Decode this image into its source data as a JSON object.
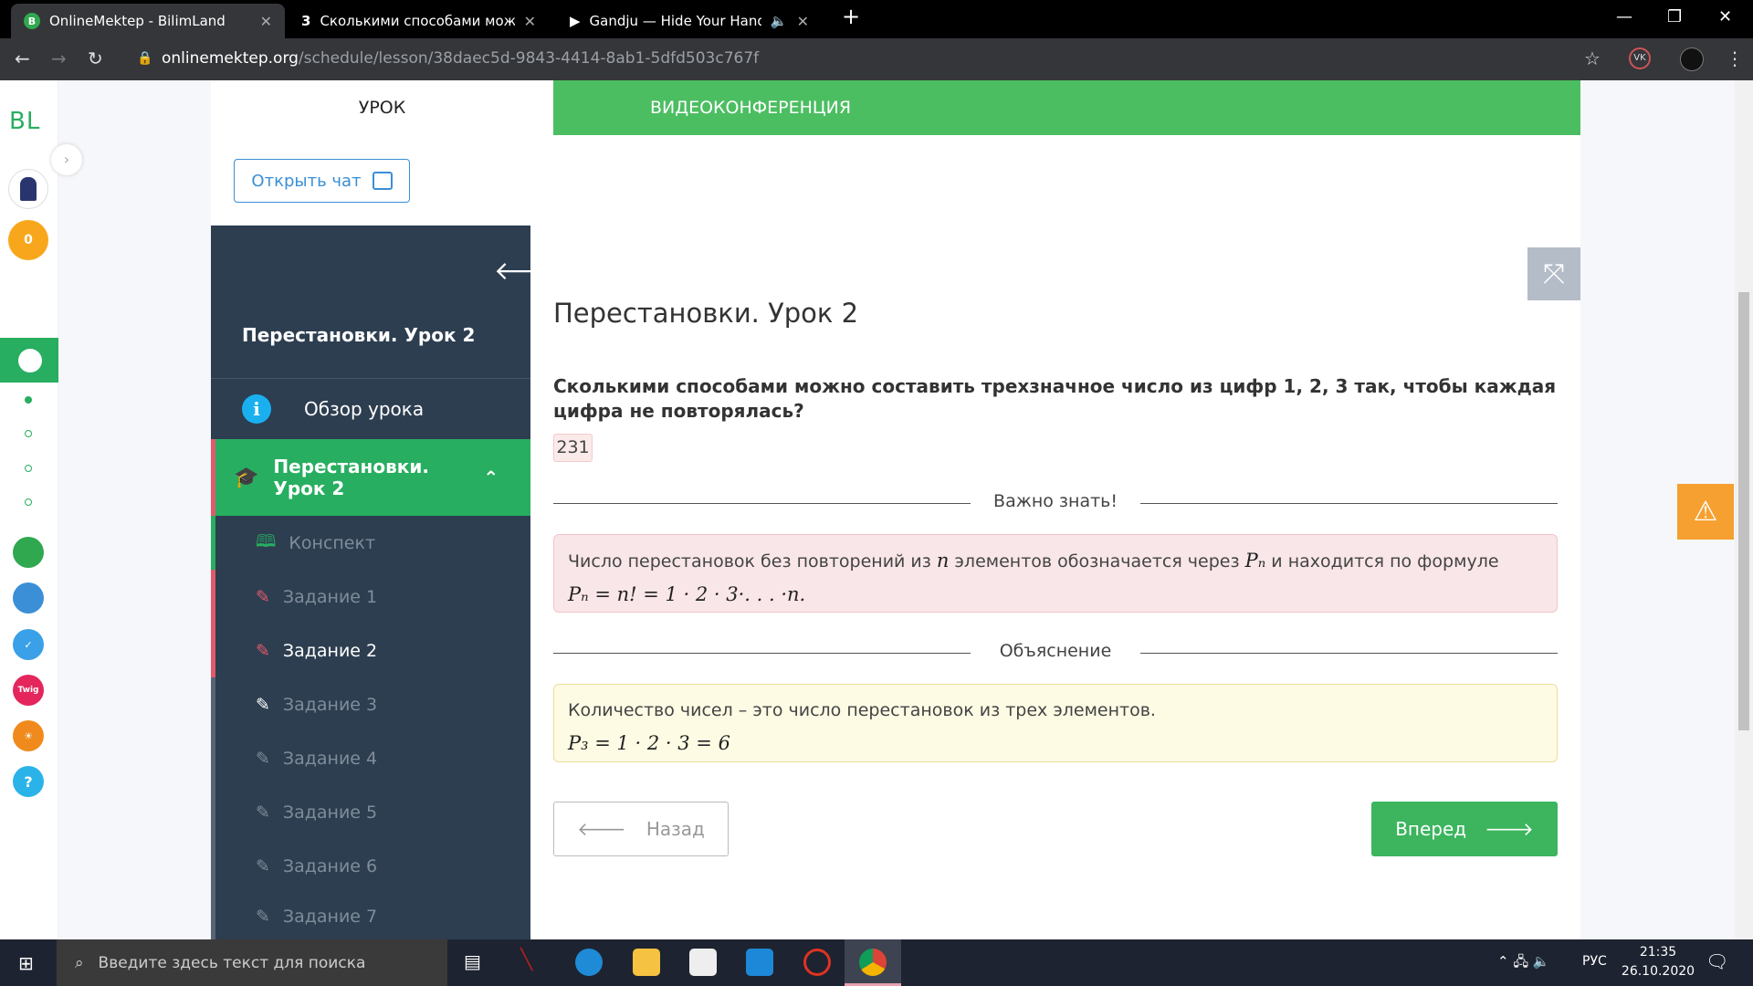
{
  "browser": {
    "tabs": [
      {
        "label": "OnlineMektep - BilimLand",
        "icon": "B"
      },
      {
        "label": "Сколькими способами можно с",
        "icon": "3"
      },
      {
        "label": "Gandju — Hide Your Hands I"
      }
    ],
    "url_host": "onlinemektep.org",
    "url_path": "/schedule/lesson/38daec5d-9843-4414-8ab1-5dfd503c767f"
  },
  "rail": {
    "logo": "BL",
    "coins": "0"
  },
  "tabs": {
    "lesson": "УРОК",
    "video": "ВИДЕОКОНФЕРЕНЦИЯ"
  },
  "chat_button": "Открыть чат",
  "sidebar": {
    "title": "Перестановки. Урок 2",
    "overview": "Обзор урока",
    "section": "Перестановки. Урок 2",
    "items": [
      {
        "label": "Конспект"
      },
      {
        "label": "Задание 1"
      },
      {
        "label": "Задание 2"
      },
      {
        "label": "Задание 3"
      },
      {
        "label": "Задание 4"
      },
      {
        "label": "Задание 5"
      },
      {
        "label": "Задание 6"
      },
      {
        "label": "Задание 7"
      }
    ]
  },
  "main": {
    "title": "Перестановки. Урок 2",
    "question": "Сколькими способами можно составить трехзначное число из цифр 1, 2, 3 так, чтобы каждая цифра не повторялась?",
    "answer": "231",
    "important_label": "Важно знать!",
    "important_text_a": "Число перестановок без повторений из ",
    "important_n": "n",
    "important_text_b": " элементов обозначается через ",
    "important_Pn": "Pₙ",
    "important_text_c": " и находится по формуле",
    "important_formula": "Pₙ = n! = 1 · 2 · 3·. . . ·n.",
    "explanation_label": "Объяснение",
    "explanation_text": "Количество чисел – это число перестановок из трех элементов.",
    "explanation_formula": "P₃ = 1 · 2 · 3 = 6",
    "back": "Назад",
    "next": "Вперед"
  },
  "taskbar": {
    "search_placeholder": "Введите здесь текст для поиска",
    "lang": "РУС",
    "time": "21:35",
    "date": "26.10.2020"
  },
  "colors": {
    "green": "#4cbe62",
    "dark": "#2d3e50",
    "accent_red": "#e05a6a",
    "warning": "#f5a031"
  }
}
